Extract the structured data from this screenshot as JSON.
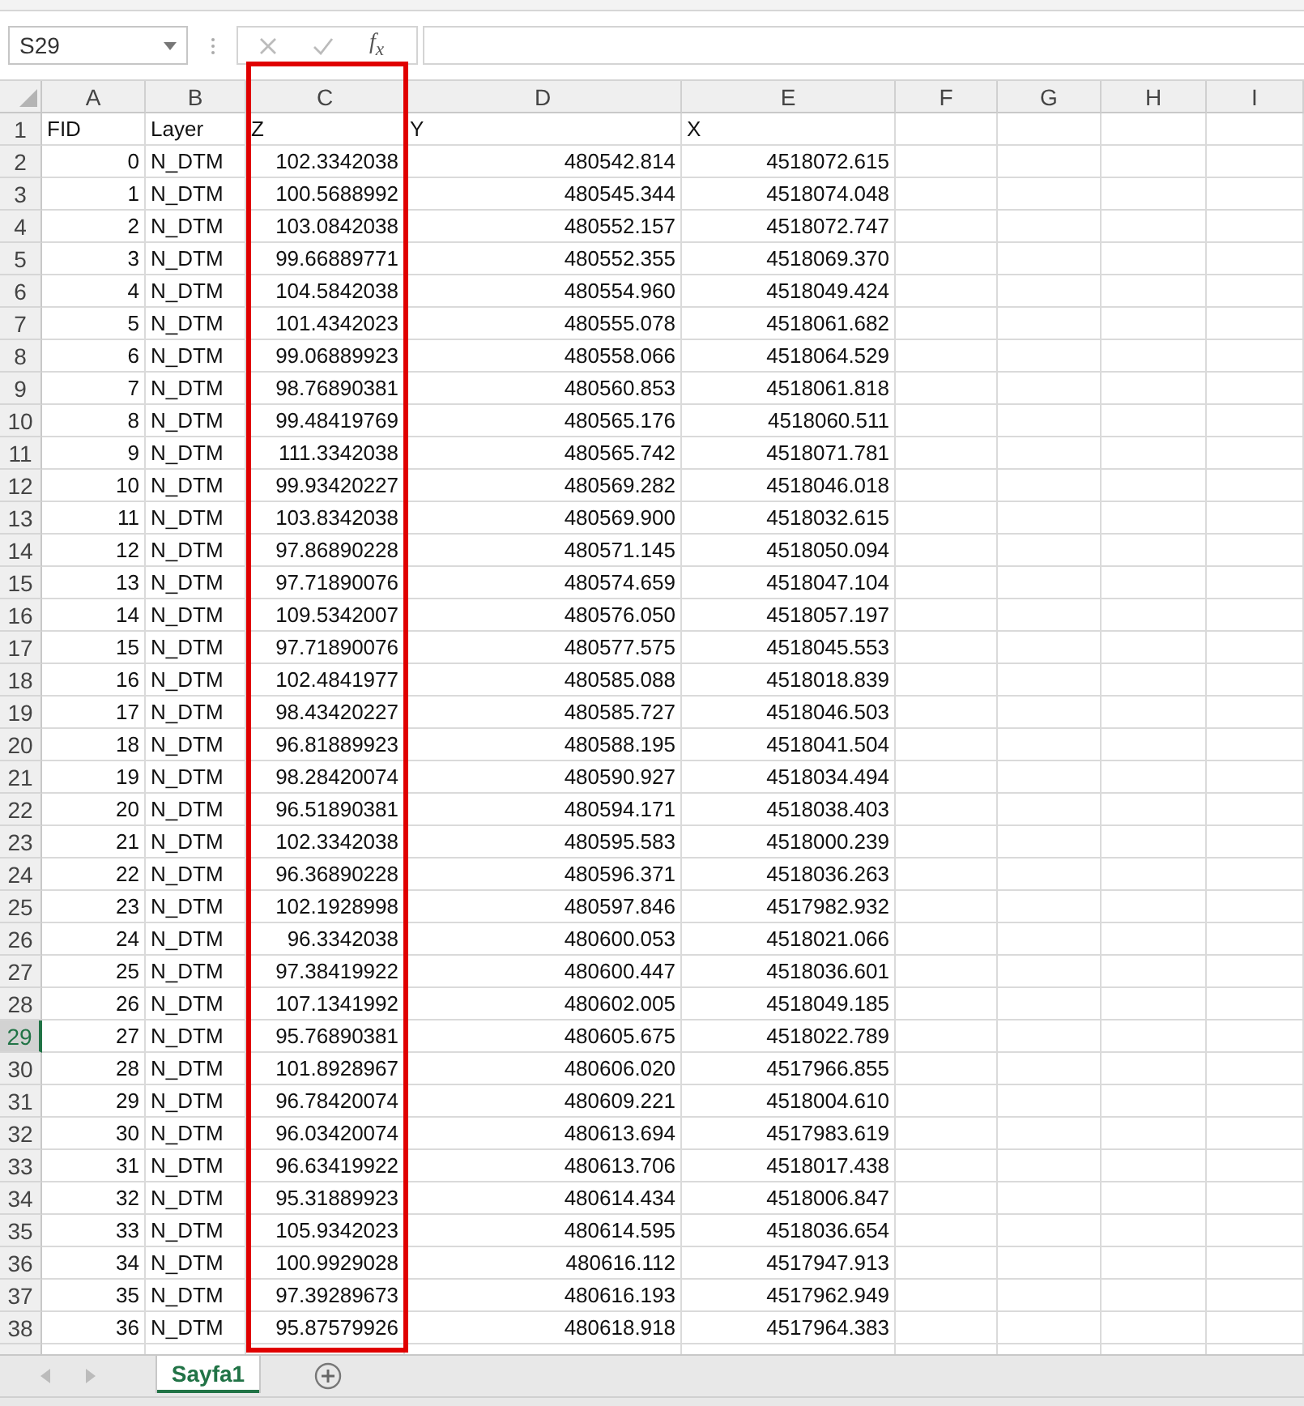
{
  "name_box": "S29",
  "formula_bar": {
    "function_label": "f$_{x}$"
  },
  "columns": [
    "A",
    "B",
    "C",
    "D",
    "E",
    "F",
    "G",
    "H",
    "I"
  ],
  "rows": [
    {
      "number": "1",
      "kind": "header",
      "selected": false,
      "cells": [
        "FID",
        "Layer",
        "Z",
        "Y",
        "X"
      ]
    },
    {
      "number": "2",
      "kind": "data",
      "selected": false,
      "cells": [
        "0",
        "N_DTM",
        "102.3342038",
        "480542.814",
        "4518072.615"
      ]
    },
    {
      "number": "3",
      "kind": "data",
      "selected": false,
      "cells": [
        "1",
        "N_DTM",
        "100.5688992",
        "480545.344",
        "4518074.048"
      ]
    },
    {
      "number": "4",
      "kind": "data",
      "selected": false,
      "cells": [
        "2",
        "N_DTM",
        "103.0842038",
        "480552.157",
        "4518072.747"
      ]
    },
    {
      "number": "5",
      "kind": "data",
      "selected": false,
      "cells": [
        "3",
        "N_DTM",
        "99.66889771",
        "480552.355",
        "4518069.370"
      ]
    },
    {
      "number": "6",
      "kind": "data",
      "selected": false,
      "cells": [
        "4",
        "N_DTM",
        "104.5842038",
        "480554.960",
        "4518049.424"
      ]
    },
    {
      "number": "7",
      "kind": "data",
      "selected": false,
      "cells": [
        "5",
        "N_DTM",
        "101.4342023",
        "480555.078",
        "4518061.682"
      ]
    },
    {
      "number": "8",
      "kind": "data",
      "selected": false,
      "cells": [
        "6",
        "N_DTM",
        "99.06889923",
        "480558.066",
        "4518064.529"
      ]
    },
    {
      "number": "9",
      "kind": "data",
      "selected": false,
      "cells": [
        "7",
        "N_DTM",
        "98.76890381",
        "480560.853",
        "4518061.818"
      ]
    },
    {
      "number": "10",
      "kind": "data",
      "selected": false,
      "cells": [
        "8",
        "N_DTM",
        "99.48419769",
        "480565.176",
        "4518060.511"
      ]
    },
    {
      "number": "11",
      "kind": "data",
      "selected": false,
      "cells": [
        "9",
        "N_DTM",
        "111.3342038",
        "480565.742",
        "4518071.781"
      ]
    },
    {
      "number": "12",
      "kind": "data",
      "selected": false,
      "cells": [
        "10",
        "N_DTM",
        "99.93420227",
        "480569.282",
        "4518046.018"
      ]
    },
    {
      "number": "13",
      "kind": "data",
      "selected": false,
      "cells": [
        "11",
        "N_DTM",
        "103.8342038",
        "480569.900",
        "4518032.615"
      ]
    },
    {
      "number": "14",
      "kind": "data",
      "selected": false,
      "cells": [
        "12",
        "N_DTM",
        "97.86890228",
        "480571.145",
        "4518050.094"
      ]
    },
    {
      "number": "15",
      "kind": "data",
      "selected": false,
      "cells": [
        "13",
        "N_DTM",
        "97.71890076",
        "480574.659",
        "4518047.104"
      ]
    },
    {
      "number": "16",
      "kind": "data",
      "selected": false,
      "cells": [
        "14",
        "N_DTM",
        "109.5342007",
        "480576.050",
        "4518057.197"
      ]
    },
    {
      "number": "17",
      "kind": "data",
      "selected": false,
      "cells": [
        "15",
        "N_DTM",
        "97.71890076",
        "480577.575",
        "4518045.553"
      ]
    },
    {
      "number": "18",
      "kind": "data",
      "selected": false,
      "cells": [
        "16",
        "N_DTM",
        "102.4841977",
        "480585.088",
        "4518018.839"
      ]
    },
    {
      "number": "19",
      "kind": "data",
      "selected": false,
      "cells": [
        "17",
        "N_DTM",
        "98.43420227",
        "480585.727",
        "4518046.503"
      ]
    },
    {
      "number": "20",
      "kind": "data",
      "selected": false,
      "cells": [
        "18",
        "N_DTM",
        "96.81889923",
        "480588.195",
        "4518041.504"
      ]
    },
    {
      "number": "21",
      "kind": "data",
      "selected": false,
      "cells": [
        "19",
        "N_DTM",
        "98.28420074",
        "480590.927",
        "4518034.494"
      ]
    },
    {
      "number": "22",
      "kind": "data",
      "selected": false,
      "cells": [
        "20",
        "N_DTM",
        "96.51890381",
        "480594.171",
        "4518038.403"
      ]
    },
    {
      "number": "23",
      "kind": "data",
      "selected": false,
      "cells": [
        "21",
        "N_DTM",
        "102.3342038",
        "480595.583",
        "4518000.239"
      ]
    },
    {
      "number": "24",
      "kind": "data",
      "selected": false,
      "cells": [
        "22",
        "N_DTM",
        "96.36890228",
        "480596.371",
        "4518036.263"
      ]
    },
    {
      "number": "25",
      "kind": "data",
      "selected": false,
      "cells": [
        "23",
        "N_DTM",
        "102.1928998",
        "480597.846",
        "4517982.932"
      ]
    },
    {
      "number": "26",
      "kind": "data",
      "selected": false,
      "cells": [
        "24",
        "N_DTM",
        "96.3342038",
        "480600.053",
        "4518021.066"
      ]
    },
    {
      "number": "27",
      "kind": "data",
      "selected": false,
      "cells": [
        "25",
        "N_DTM",
        "97.38419922",
        "480600.447",
        "4518036.601"
      ]
    },
    {
      "number": "28",
      "kind": "data",
      "selected": false,
      "cells": [
        "26",
        "N_DTM",
        "107.1341992",
        "480602.005",
        "4518049.185"
      ]
    },
    {
      "number": "29",
      "kind": "data",
      "selected": true,
      "cells": [
        "27",
        "N_DTM",
        "95.76890381",
        "480605.675",
        "4518022.789"
      ]
    },
    {
      "number": "30",
      "kind": "data",
      "selected": false,
      "cells": [
        "28",
        "N_DTM",
        "101.8928967",
        "480606.020",
        "4517966.855"
      ]
    },
    {
      "number": "31",
      "kind": "data",
      "selected": false,
      "cells": [
        "29",
        "N_DTM",
        "96.78420074",
        "480609.221",
        "4518004.610"
      ]
    },
    {
      "number": "32",
      "kind": "data",
      "selected": false,
      "cells": [
        "30",
        "N_DTM",
        "96.03420074",
        "480613.694",
        "4517983.619"
      ]
    },
    {
      "number": "33",
      "kind": "data",
      "selected": false,
      "cells": [
        "31",
        "N_DTM",
        "96.63419922",
        "480613.706",
        "4518017.438"
      ]
    },
    {
      "number": "34",
      "kind": "data",
      "selected": false,
      "cells": [
        "32",
        "N_DTM",
        "95.31889923",
        "480614.434",
        "4518006.847"
      ]
    },
    {
      "number": "35",
      "kind": "data",
      "selected": false,
      "cells": [
        "33",
        "N_DTM",
        "105.9342023",
        "480614.595",
        "4518036.654"
      ]
    },
    {
      "number": "36",
      "kind": "data",
      "selected": false,
      "cells": [
        "34",
        "N_DTM",
        "100.9929028",
        "480616.112",
        "4517947.913"
      ]
    },
    {
      "number": "37",
      "kind": "data",
      "selected": false,
      "cells": [
        "35",
        "N_DTM",
        "97.39289673",
        "480616.193",
        "4517962.949"
      ]
    },
    {
      "number": "38",
      "kind": "data",
      "selected": false,
      "cells": [
        "36",
        "N_DTM",
        "95.87579926",
        "480618.918",
        "4517964.383"
      ]
    }
  ],
  "sheet_tabs": [
    {
      "label": "Sayfa1",
      "selected": true
    }
  ]
}
